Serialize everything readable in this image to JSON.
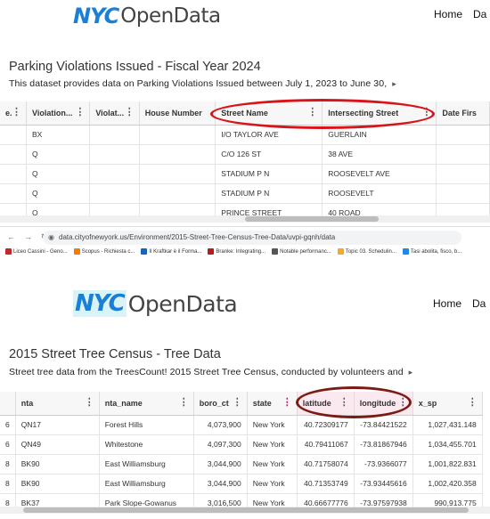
{
  "top": {
    "logo": {
      "nyc": "NYC",
      "opendata": "OpenData"
    },
    "nav": [
      "Home",
      "Da"
    ],
    "title": "Parking Violations Issued - Fiscal Year 2024",
    "description": "This dataset provides data on Parking Violations Issued between July 1, 2023 to June 30,",
    "columns": [
      "e.",
      "Violation...",
      "Violat...",
      "House Number",
      "Street Name",
      "Intersecting Street",
      "Date Firs"
    ],
    "rows": [
      [
        "",
        "BX",
        "",
        "",
        "I/O TAYLOR AVE",
        "GUERLAIN",
        ""
      ],
      [
        "",
        "Q",
        "",
        "",
        "C/O 126 ST",
        "38 AVE",
        ""
      ],
      [
        "",
        "Q",
        "",
        "",
        "STADIUM P N",
        "ROOSEVELT AVE",
        ""
      ],
      [
        "",
        "Q",
        "",
        "",
        "STADIUM P N",
        "ROOSEVELT",
        ""
      ],
      [
        "",
        "Q",
        "",
        "",
        "PRINCE STREET",
        "40 ROAD",
        ""
      ]
    ]
  },
  "browser": {
    "nav_icons": [
      "←",
      "→",
      "↻"
    ],
    "url": "data.cityofnewyork.us/Environment/2015-Street-Tree-Census-Tree-Data/uvpi-gqnh/data",
    "bookmarks": [
      {
        "label": "Liceo Cassini - Geno...",
        "color": "#c62828"
      },
      {
        "label": "Scopus - Richiesta c...",
        "color": "#f57c00"
      },
      {
        "label": "Il Kraftkar è il Forma...",
        "color": "#1565c0"
      },
      {
        "label": "Branke: Integrating...",
        "color": "#b71c1c"
      },
      {
        "label": "Notable performanc...",
        "color": "#555555"
      },
      {
        "label": "Topic 03. Schedulin...",
        "color": "#f9a825"
      },
      {
        "label": "Tasi abolita, fisco, b...",
        "color": "#1e88e5"
      }
    ]
  },
  "bottom": {
    "logo": {
      "nyc": "NYC",
      "opendata": "OpenData"
    },
    "nav": [
      "Home",
      "Da"
    ],
    "title": "2015 Street Tree Census - Tree Data",
    "description": "Street tree data from the TreesCount! 2015 Street Tree Census, conducted by volunteers and",
    "columns": [
      "",
      "nta",
      "nta_name",
      "boro_ct",
      "state",
      "latitude",
      "longitude",
      "x_sp"
    ],
    "rows": [
      [
        "6",
        "QN17",
        "Forest Hills",
        "4,073,900",
        "New York",
        "40.72309177",
        "-73.84421522",
        "1,027,431.148"
      ],
      [
        "6",
        "QN49",
        "Whitestone",
        "4,097,300",
        "New York",
        "40.79411067",
        "-73.81867946",
        "1,034,455.701"
      ],
      [
        "8",
        "BK90",
        "East Williamsburg",
        "3,044,900",
        "New York",
        "40.71758074",
        "-73.9366077",
        "1,001,822.831"
      ],
      [
        "8",
        "BK90",
        "East Williamsburg",
        "3,044,900",
        "New York",
        "40.71353749",
        "-73.93445616",
        "1,002,420.358"
      ],
      [
        "8",
        "BK37",
        "Park Slope-Gowanus",
        "3,016,500",
        "New York",
        "40.66677776",
        "-73.97597938",
        "990,913.775"
      ]
    ]
  },
  "colors": {
    "logo_blue": "#1a7fd6",
    "highlight_red": "#d7141a",
    "highlight_dark_red": "#7a1c14"
  }
}
